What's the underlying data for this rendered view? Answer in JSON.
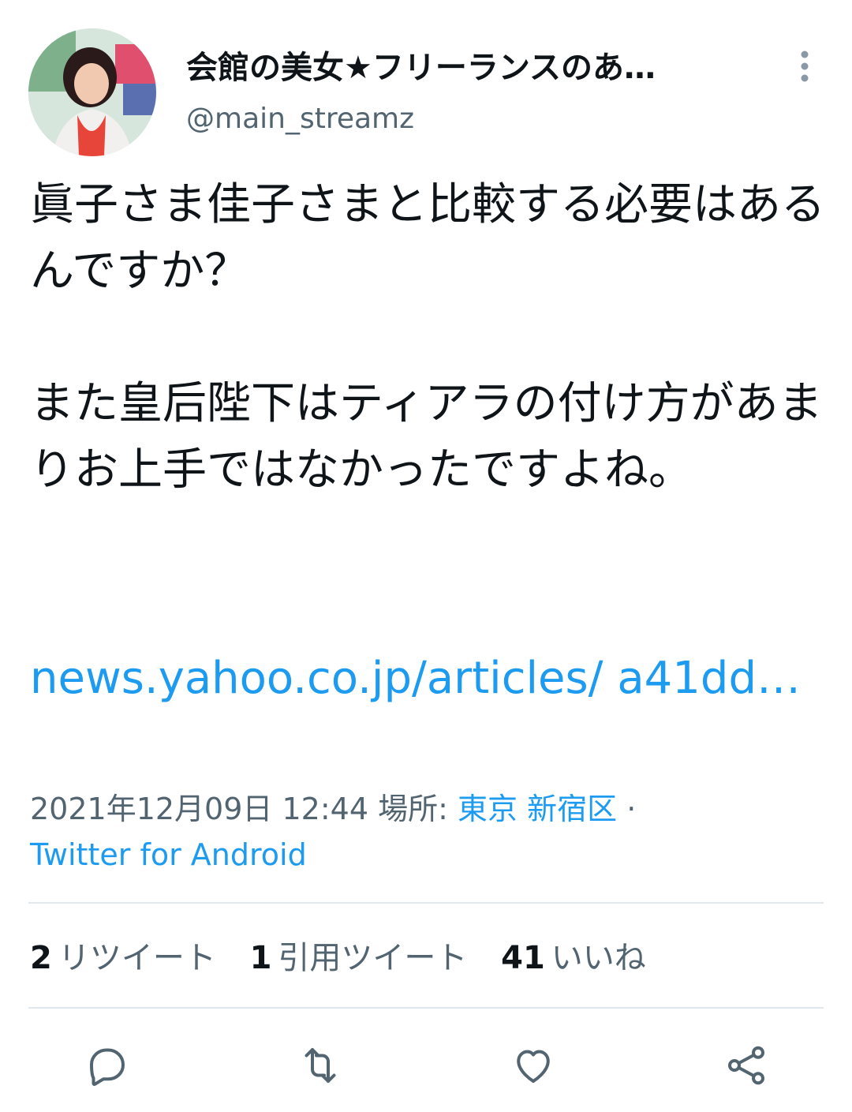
{
  "user": {
    "display_name": "会館の美女★フリーランスのあ…",
    "handle": "@main_streamz",
    "avatar_icon": "profile-photo"
  },
  "tweet": {
    "line1": "眞子さま佳子さまと比較する必要はあるんですか？",
    "line2": "また皇后陛下はティアラの付け方があまりお上手ではなかったですよね。",
    "link": "news.yahoo.co.jp/articles/ a41dd…"
  },
  "meta": {
    "datetime": "2021年12月09日 12:44",
    "place_label": "場所:",
    "place": "東京 新宿区",
    "separator": "·",
    "client": "Twitter for Android"
  },
  "stats": {
    "retweets": "2",
    "retweets_label": "リツイート",
    "quotes": "1",
    "quotes_label": "引用ツイート",
    "likes": "41",
    "likes_label": "いいね"
  },
  "colors": {
    "accent": "#1d9bf0",
    "secondary_text": "#536471",
    "primary_text": "#0f1419",
    "divider": "#e1e8ed"
  },
  "icons": {
    "more": "more-vertical-icon",
    "reply": "reply-icon",
    "retweet": "retweet-icon",
    "like": "heart-icon",
    "share": "share-icon"
  }
}
